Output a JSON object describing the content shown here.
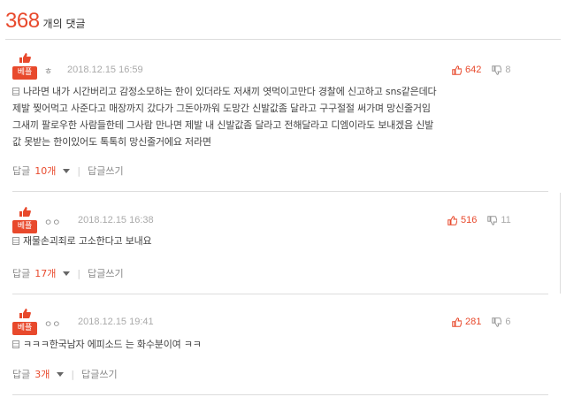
{
  "header": {
    "count": "368",
    "suffix": "개의 댓글"
  },
  "comments": [
    {
      "badge": "베플",
      "nick": "ㅎ",
      "date": "2018.12.15 16:59",
      "up": "642",
      "down": "8",
      "lines": [
        "나라면 내가 시간버리고 감정소모하는 한이 있더라도 저새끼 엿먹이고만다 경찰에 신고하고 sns같은데다",
        "제발 찢어먹고 사준다고 매장까지 갔다가 그돈아까워 도망간 신발값좀 달라고 구구절절 써가며 망신줄거임",
        "그새끼 팔로우한 사람들한테 그사람 만나면 제발 내 신발값좀 달라고 전해달라고 디엠이라도 보내겠음 신발",
        "값 못받는 한이있어도 톡톡히 망신줄거에요 저라면"
      ],
      "reply_label": "답글",
      "reply_count": "10개",
      "write_label": "답글쓰기"
    },
    {
      "badge": "베플",
      "nick": "ㅇㅇ",
      "date": "2018.12.15 16:38",
      "up": "516",
      "down": "11",
      "lines": [
        "재물손괴죄로 고소한다고 보내요"
      ],
      "reply_label": "답글",
      "reply_count": "17개",
      "write_label": "답글쓰기"
    },
    {
      "badge": "베플",
      "nick": "ㅇㅇ",
      "date": "2018.12.15 19:41",
      "up": "281",
      "down": "6",
      "lines": [
        "ㅋㅋㅋ한국남자 에피소드 는 화수분이여 ㅋㅋ"
      ],
      "reply_label": "답글",
      "reply_count": "3개",
      "write_label": "답글쓰기"
    }
  ]
}
